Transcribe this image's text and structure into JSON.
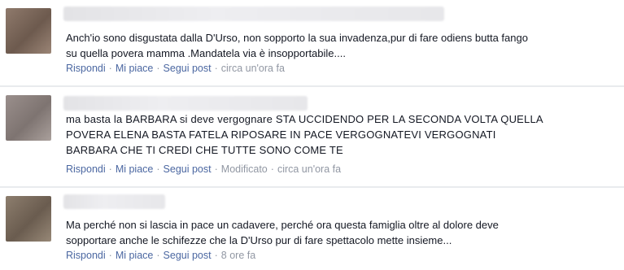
{
  "comments": [
    {
      "text_lines": [
        "Anch'io sono disgustata dalla D'Urso, non sopporto la sua invadenza,pur di fare odiens butta fango",
        "su quella povera mamma .Mandatela via è insopportabile...."
      ],
      "reply": "Rispondi",
      "like": "Mi piace",
      "follow": "Segui post",
      "edited": "",
      "time": "circa un'ora fa"
    },
    {
      "text_lines": [
        "ma basta la BARBARA si deve vergognare STA UCCIDENDO PER LA SECONDA VOLTA QUELLA",
        "POVERA ELENA BASTA FATELA RIPOSARE IN PACE VERGOGNATEVI VERGOGNATI",
        "BARBARA CHE TI CREDI CHE TUTTE SONO COME TE"
      ],
      "reply": "Rispondi",
      "like": "Mi piace",
      "follow": "Segui post",
      "edited": "Modificato",
      "time": "circa un'ora fa"
    },
    {
      "text_lines": [
        "Ma perché non si lascia in pace un cadavere, perché ora questa famiglia oltre al dolore deve",
        "sopportare anche le schifezze che la D'Urso pur di fare spettacolo mette insieme..."
      ],
      "reply": "Rispondi",
      "like": "Mi piace",
      "follow": "Segui post",
      "edited": "",
      "time": "8 ore fa"
    }
  ],
  "separator": "·",
  "colors": {
    "link": "#4b67a1",
    "meta": "#9197a3",
    "text": "#141823",
    "divider": "#e9ebee"
  }
}
